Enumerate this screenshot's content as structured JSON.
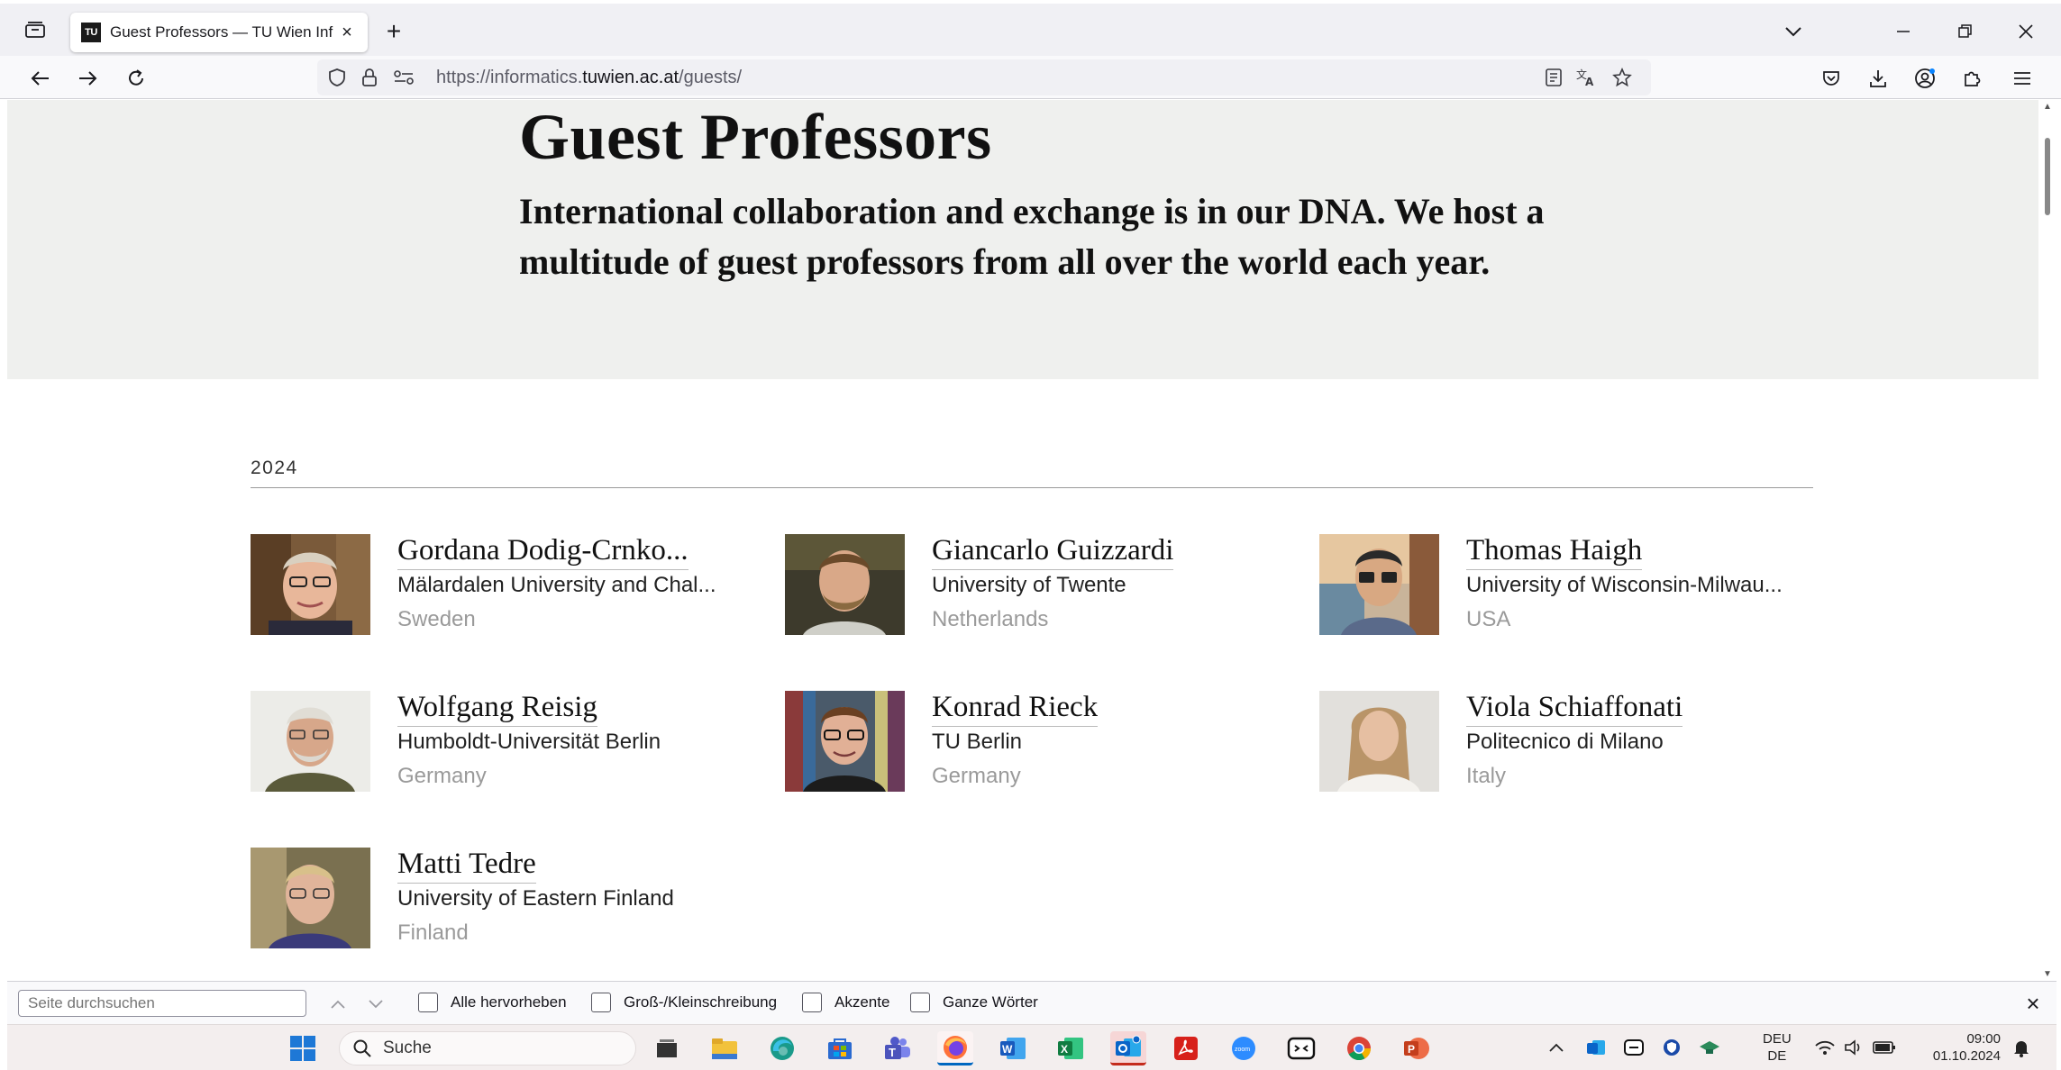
{
  "browser": {
    "tab_title": "Guest Professors — TU Wien Inf",
    "tab_favicon_text": "TU",
    "url_prefix": "https://informatics.",
    "url_domain": "tuwien.ac.at",
    "url_suffix": "/guests/"
  },
  "page": {
    "title": "Guest Professors",
    "lead": "International collaboration and exchange is in our DNA. We host a multitude of guest professors from all over the world each year.",
    "year": "2024",
    "guests": [
      {
        "name": "Gordana Dodig-Crnko...",
        "institution": "Mälardalen University and Chal...",
        "country": "Sweden"
      },
      {
        "name": "Giancarlo Guizzardi",
        "institution": "University of Twente",
        "country": "Netherlands"
      },
      {
        "name": "Thomas Haigh",
        "institution": "University of Wisconsin-Milwau...",
        "country": "USA"
      },
      {
        "name": "Wolfgang Reisig",
        "institution": "Humboldt-Universität Berlin",
        "country": "Germany"
      },
      {
        "name": "Konrad Rieck",
        "institution": "TU Berlin",
        "country": "Germany"
      },
      {
        "name": "Viola Schiaffonati",
        "institution": "Politecnico di Milano",
        "country": "Italy"
      },
      {
        "name": "Matti Tedre",
        "institution": "University of Eastern Finland",
        "country": "Finland"
      }
    ]
  },
  "findbar": {
    "placeholder": "Seite durchsuchen",
    "options": [
      "Alle hervorheben",
      "Groß-/Kleinschreibung",
      "Akzente",
      "Ganze Wörter"
    ]
  },
  "taskbar": {
    "search_label": "Suche",
    "lang_line1": "DEU",
    "lang_line2": "DE",
    "time": "09:00",
    "date": "01.10.2024"
  }
}
